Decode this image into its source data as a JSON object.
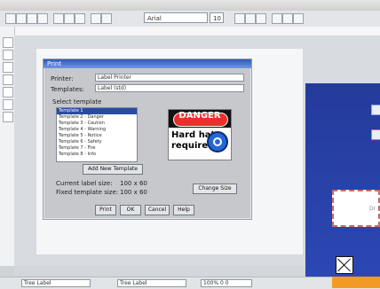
{
  "toolbar": {
    "font_name": "Arial",
    "size_value": "10"
  },
  "dialog": {
    "title": "Print",
    "printer_label": "Printer:",
    "printer_value": "Label Printer",
    "printer_2_label": "Templates:",
    "printer_2_value": "Label (std)",
    "section_label": "Select template",
    "list_items": [
      "Template 1",
      "Template 2 - Danger",
      "Template 3 - Caution",
      "Template 4 - Warning",
      "Template 5 - Notice",
      "Template 6 - Safety",
      "Template 7 - Fire",
      "Template 8 - Info"
    ],
    "selected_index": 0,
    "add_button": "Add New Template",
    "opt1_label": "Current label size:",
    "opt1_value": "100 x 60",
    "opt2_label": "Fixed template size:",
    "opt2_value": "100 x 60",
    "change_button": "Change Size",
    "buttons": [
      "Print",
      "OK",
      "Cancel",
      "Help"
    ]
  },
  "sign": {
    "header": "DANGER",
    "line1": "Hard hat",
    "line2": "required"
  },
  "status": {
    "left": "Tree Label",
    "middle": "Tree Label",
    "right": "100% 0 0"
  },
  "colors": {
    "accent": "#2c48b5",
    "danger": "#ef2d2d",
    "orange": "#f39b24"
  }
}
